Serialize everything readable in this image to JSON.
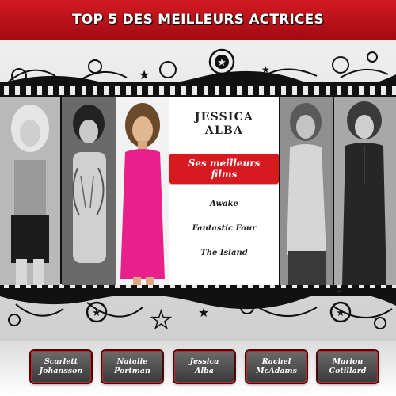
{
  "header": {
    "title": "TOP 5 DES MEILLEURS ACTRICES"
  },
  "featured": {
    "name_line1": "JESSICA",
    "name_line2": "ALBA",
    "films_button": "Ses meilleurs films",
    "films": [
      "Awake",
      "Fantastic Four",
      "The Island"
    ]
  },
  "nav": {
    "buttons": [
      {
        "line1": "Scarlett",
        "line2": "Johansson"
      },
      {
        "line1": "Natalie",
        "line2": "Portman"
      },
      {
        "line1": "Jessica",
        "line2": "Alba"
      },
      {
        "line1": "Rachel",
        "line2": "McAdams"
      },
      {
        "line1": "Marion",
        "line2": "Cotillard"
      }
    ]
  },
  "colors": {
    "accent": "#d21a22",
    "highlight": "#e8208c"
  }
}
